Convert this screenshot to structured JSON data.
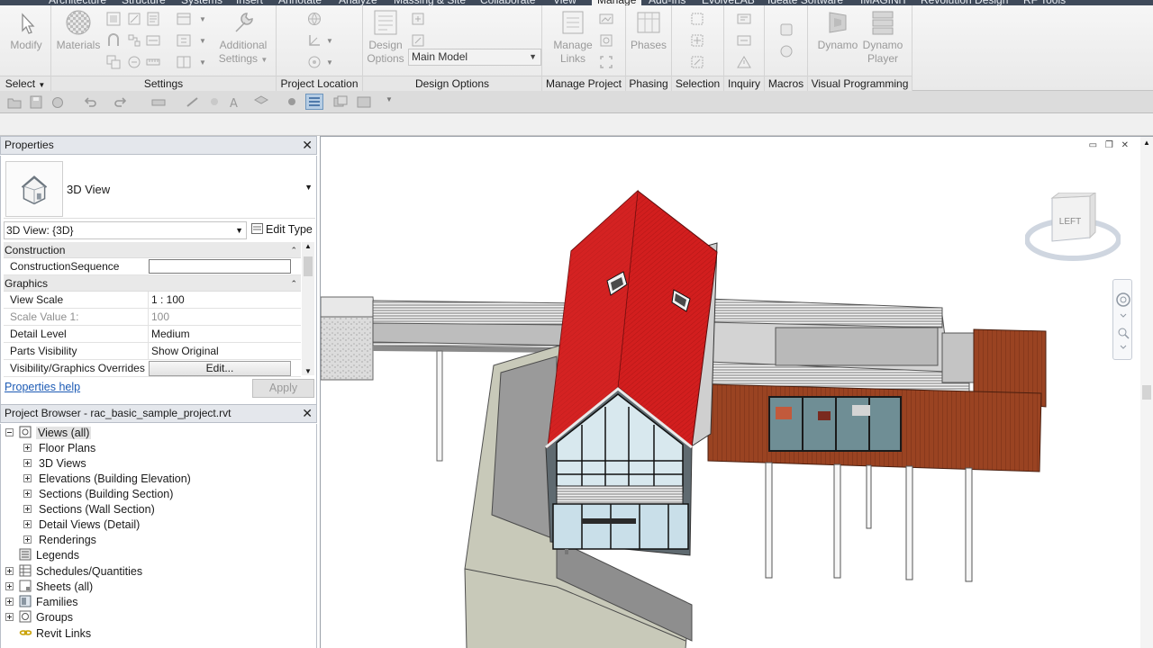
{
  "ribbon_tabs": [
    "Architecture",
    "Structure",
    "Systems",
    "Insert",
    "Annotate",
    "Analyze",
    "Massing & Site",
    "Collaborate",
    "View",
    "Manage",
    "Add-Ins",
    "EvolveLAB",
    "Ideate Software",
    "IMAGINiT",
    "Revolution Design",
    "RF Tools"
  ],
  "active_tab": "Manage",
  "ribbon": {
    "select": {
      "title": "Select",
      "modify": "Modify"
    },
    "settings": {
      "title": "Settings",
      "materials": "Materials",
      "additional": "Additional\nSettings"
    },
    "project_location": {
      "title": "Project Location"
    },
    "design_options": {
      "title": "Design Options",
      "button": "Design\nOptions",
      "combo_value": "Main Model"
    },
    "manage_project": {
      "title": "Manage Project",
      "button": "Manage\nLinks"
    },
    "phasing": {
      "title": "Phasing",
      "button": "Phases"
    },
    "selection": {
      "title": "Selection"
    },
    "inquiry": {
      "title": "Inquiry"
    },
    "macros": {
      "title": "Macros"
    },
    "visual_programming": {
      "title": "Visual Programming",
      "dynamo": "Dynamo",
      "dynamo_player": "Dynamo\nPlayer"
    }
  },
  "properties": {
    "title": "Properties",
    "type_name": "3D View",
    "instance_value": "3D View: {3D}",
    "edit_type": "Edit Type",
    "groups": [
      {
        "name": "Construction",
        "rows": [
          {
            "key": "ConstructionSequence",
            "value": "",
            "kind": "input"
          }
        ]
      },
      {
        "name": "Graphics",
        "rows": [
          {
            "key": "View Scale",
            "value": "1 : 100",
            "kind": "text"
          },
          {
            "key": "Scale Value    1:",
            "value": "100",
            "kind": "disabled"
          },
          {
            "key": "Detail Level",
            "value": "Medium",
            "kind": "text"
          },
          {
            "key": "Parts Visibility",
            "value": "Show Original",
            "kind": "text"
          },
          {
            "key": "Visibility/Graphics Overrides",
            "value": "Edit...",
            "kind": "button"
          }
        ]
      }
    ],
    "help_link": "Properties help",
    "apply": "Apply"
  },
  "project_browser": {
    "title": "Project Browser - rac_basic_sample_project.rvt",
    "nodes": [
      {
        "label": "Views (all)",
        "level": 0,
        "exp": "minus",
        "icon": "views"
      },
      {
        "label": "Floor Plans",
        "level": 1,
        "exp": "plus"
      },
      {
        "label": "3D Views",
        "level": 1,
        "exp": "plus"
      },
      {
        "label": "Elevations (Building Elevation)",
        "level": 1,
        "exp": "plus"
      },
      {
        "label": "Sections (Building Section)",
        "level": 1,
        "exp": "plus"
      },
      {
        "label": "Sections (Wall Section)",
        "level": 1,
        "exp": "plus"
      },
      {
        "label": "Detail Views (Detail)",
        "level": 1,
        "exp": "plus"
      },
      {
        "label": "Renderings",
        "level": 1,
        "exp": "plus"
      },
      {
        "label": "Legends",
        "level": 0,
        "exp": "none",
        "icon": "legend"
      },
      {
        "label": "Schedules/Quantities",
        "level": 0,
        "exp": "plus",
        "icon": "schedule"
      },
      {
        "label": "Sheets (all)",
        "level": 0,
        "exp": "plus",
        "icon": "sheet"
      },
      {
        "label": "Families",
        "level": 0,
        "exp": "plus",
        "icon": "family"
      },
      {
        "label": "Groups",
        "level": 0,
        "exp": "plus",
        "icon": "group"
      },
      {
        "label": "Revit Links",
        "level": 0,
        "exp": "none",
        "icon": "link"
      }
    ]
  },
  "viewcube_face": "LEFT",
  "colors": {
    "roof": "#cf1c1c",
    "cladding": "#8e3b1f",
    "panel_bg": "#e4e7ec"
  }
}
